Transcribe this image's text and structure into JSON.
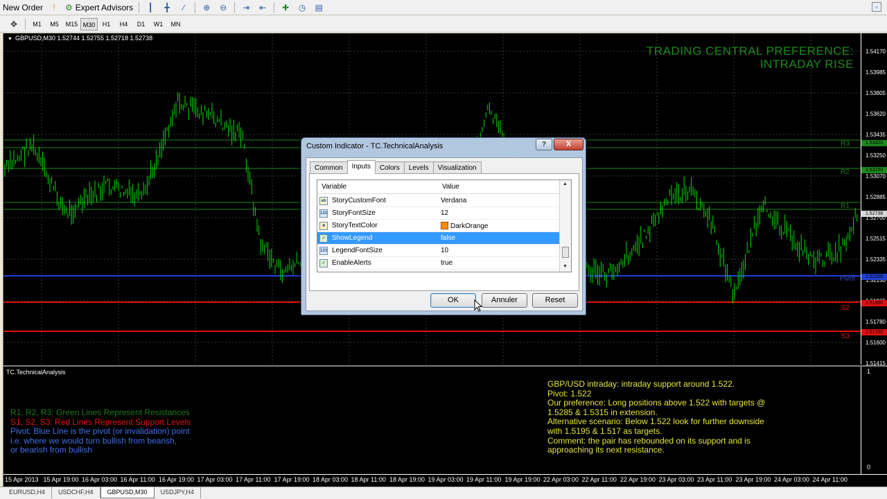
{
  "toolbar": {
    "new_order": "New Order",
    "expert_advisors": "Expert Advisors"
  },
  "timeframes": [
    "M1",
    "M5",
    "M15",
    "M30",
    "H1",
    "H4",
    "D1",
    "W1",
    "MN"
  ],
  "active_timeframe": "M30",
  "chart": {
    "title": "GBPUSD,M30  1.52744 1.52755 1.52718 1.52738",
    "banner_line1": "TRADING CENTRAL PREFERENCE:",
    "banner_line2": "INTRADAY RISE",
    "level_labels": [
      "R3",
      "R2",
      "R1",
      "Pivot",
      "S2",
      "S3"
    ],
    "price_ticks": [
      "1.54170",
      "1.53985",
      "1.53805",
      "1.53620",
      "1.53435",
      "1.53250",
      "1.53070",
      "1.52885",
      "1.52700",
      "1.52515",
      "1.52335",
      "1.52150",
      "1.51965",
      "1.51780",
      "1.51600",
      "1.51415"
    ],
    "price_tags": [
      "1.53420",
      "1.53150",
      "1.52738",
      "1.52200",
      "1.51900",
      "1.51700"
    ],
    "time_ticks": [
      "15 Apr 2013",
      "15 Apr 19:00",
      "16 Apr 03:00",
      "16 Apr 11:00",
      "16 Apr 19:00",
      "17 Apr 03:00",
      "17 Apr 11:00",
      "17 Apr 19:00",
      "18 Apr 03:00",
      "18 Apr 11:00",
      "18 Apr 19:00",
      "19 Apr 03:00",
      "19 Apr 11:00",
      "19 Apr 19:00",
      "22 Apr 03:00",
      "22 Apr 11:00",
      "22 Apr 19:00",
      "23 Apr 03:00",
      "23 Apr 11:00",
      "23 Apr 19:00",
      "24 Apr 03:00",
      "24 Apr 11:00"
    ],
    "colors": {
      "resistance": "#1c8a1c",
      "support": "#e01010",
      "pivot": "#2040d0",
      "candles": "#00e000"
    }
  },
  "subwindow": {
    "title": "TC.TechnicalAnalysis",
    "scale_top": "1",
    "scale_bottom": "0",
    "legend": [
      {
        "text": "R1, R2, R3: Green Lines Represent Resistances",
        "color": "#1c7a1c"
      },
      {
        "text": "S1, S2, S3: Red Lines Represent Support Levels",
        "color": "#e01010"
      },
      {
        "text": "Pivot: Blue Line is the pivot (or invalidation) point",
        "color": "#4070e8"
      },
      {
        "text": "i.e. where we would turn bullish from bearish,",
        "color": "#4070e8"
      },
      {
        "text": "or bearish from bullish",
        "color": "#4070e8"
      }
    ],
    "analysis": [
      "GBP/USD intraday: intraday support around 1.522.",
      "Pivot: 1.522",
      "Our preference: Long positions above 1.522 with targets @",
      "1.5285 & 1.5315 in extension.",
      "Alternative scenario: Below 1.522 look for further downside",
      "with 1.5195 & 1.517 as targets.",
      "Comment: the pair has rebounded on its support and is",
      "approaching its next resistance."
    ]
  },
  "bottom_tabs": [
    "EURUSD,H4",
    "USDCHF,H4",
    "GBPUSD,M30",
    "USDJPY,H4"
  ],
  "active_bottom_tab": "GBPUSD,M30",
  "dialog": {
    "title": "Custom Indicator - TC.TechnicalAnalysis",
    "help": "?",
    "close": "X",
    "tabs": [
      "Common",
      "Inputs",
      "Colors",
      "Levels",
      "Visualization"
    ],
    "active_tab": "Inputs",
    "col_variable": "Variable",
    "col_value": "Value",
    "rows": [
      {
        "icon": "ab",
        "name": "StoryCustomFont",
        "value": "Verdana"
      },
      {
        "icon": "123",
        "name": "StoryFontSize",
        "value": "12"
      },
      {
        "icon": "col",
        "name": "StoryTextColor",
        "value": "DarkOrange"
      },
      {
        "icon": "bool",
        "name": "ShowLegend",
        "value": "false"
      },
      {
        "icon": "123",
        "name": "LegendFontSize",
        "value": "10"
      },
      {
        "icon": "bool",
        "name": "EnableAlerts",
        "value": "true"
      }
    ],
    "selected_row": 3,
    "ok": "OK",
    "cancel": "Annuler",
    "reset": "Reset"
  }
}
